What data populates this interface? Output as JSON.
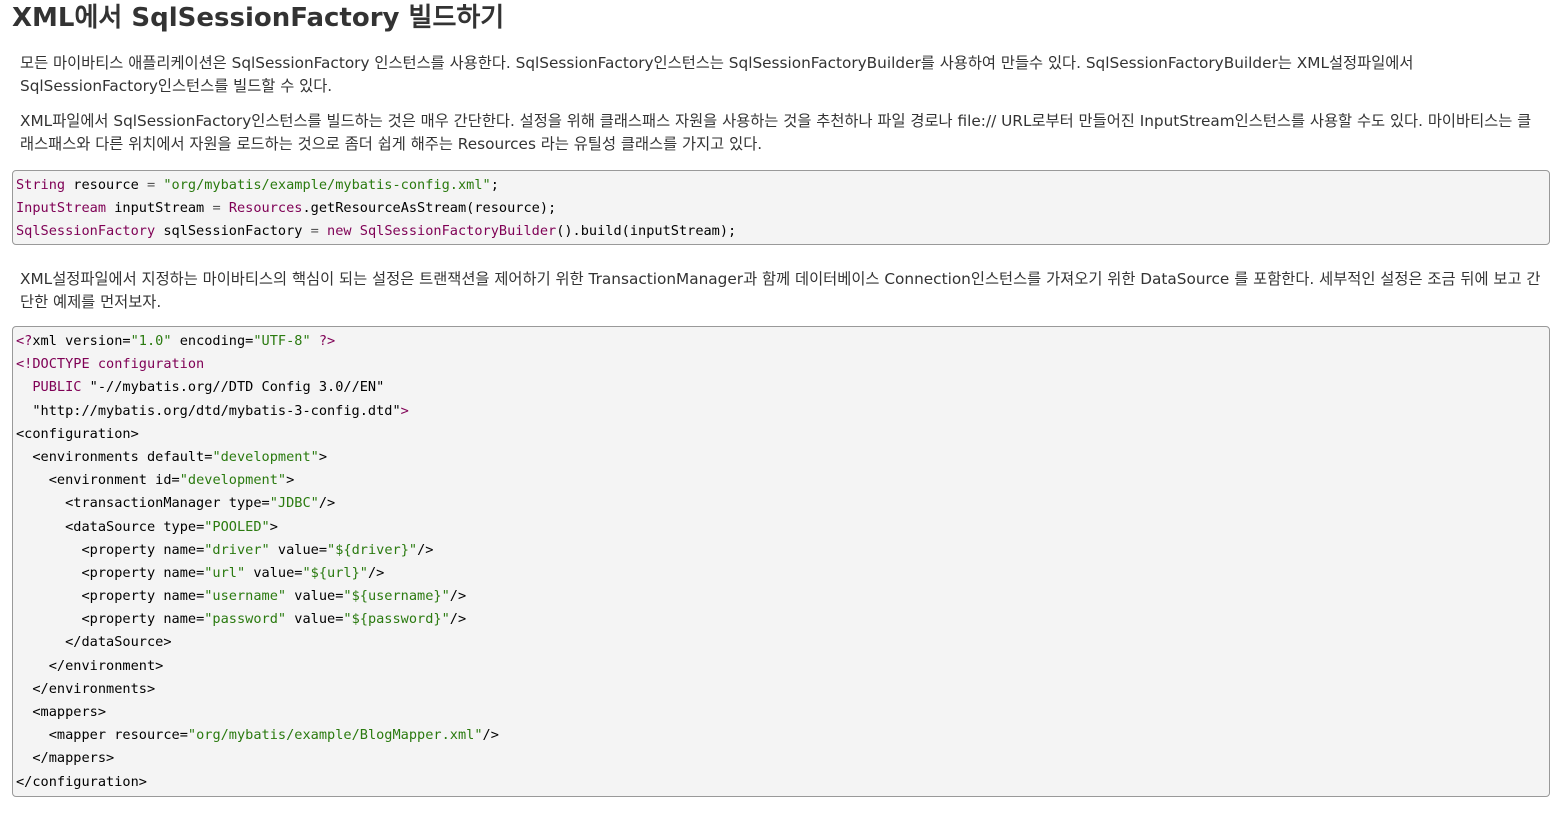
{
  "title": "XML에서 SqlSessionFactory 빌드하기",
  "paragraphs": [
    "모든 마이바티스 애플리케이션은 SqlSessionFactory 인스턴스를 사용한다. SqlSessionFactory인스턴스는 SqlSessionFactoryBuilder를 사용하여 만들수 있다. SqlSessionFactoryBuilder는 XML설정파일에서 SqlSessionFactory인스턴스를 빌드할 수 있다.",
    "XML파일에서 SqlSessionFactory인스턴스를 빌드하는 것은 매우 간단한다. 설정을 위해 클래스패스 자원을 사용하는 것을 추천하나 파일 경로나 file:// URL로부터 만들어진 InputStream인스턴스를 사용할 수도 있다. 마이바티스는 클래스패스와 다른 위치에서 자원을 로드하는 것으로 좀더 쉽게 해주는 Resources 라는 유틸성 클래스를 가지고 있다.",
    "XML설정파일에서 지정하는 마이바티스의 핵심이 되는 설정은 트랜잭션을 제어하기 위한 TransactionManager과 함께 데이터베이스 Connection인스턴스를 가져오기 위한 DataSource 를 포함한다. 세부적인 설정은 조금 뒤에 보고 간단한 예제를 먼저보자."
  ],
  "code_java": [
    [
      [
        "t",
        "String"
      ],
      [
        "n",
        " resource "
      ],
      [
        "o",
        "="
      ],
      [
        "n",
        " "
      ],
      [
        "s",
        "\"org/mybatis/example/mybatis-config.xml\""
      ],
      [
        "n",
        ";"
      ]
    ],
    [
      [
        "t",
        "InputStream"
      ],
      [
        "n",
        " inputStream "
      ],
      [
        "o",
        "="
      ],
      [
        "n",
        " "
      ],
      [
        "t",
        "Resources"
      ],
      [
        "n",
        ".getResourceAsStream(resource);"
      ]
    ],
    [
      [
        "t",
        "SqlSessionFactory"
      ],
      [
        "n",
        " sqlSessionFactory "
      ],
      [
        "o",
        "="
      ],
      [
        "n",
        " "
      ],
      [
        "t",
        "new"
      ],
      [
        "n",
        " "
      ],
      [
        "t",
        "SqlSessionFactoryBuilder"
      ],
      [
        "n",
        "().build(inputStream);"
      ]
    ]
  ],
  "code_xml": [
    [
      [
        "t",
        "<?"
      ],
      [
        "n",
        "xml version="
      ],
      [
        "s",
        "\"1.0\""
      ],
      [
        "n",
        " encoding="
      ],
      [
        "s",
        "\"UTF-8\""
      ],
      [
        "n",
        " "
      ],
      [
        "t",
        "?>"
      ]
    ],
    [
      [
        "t",
        "<!DOCTYPE configuration"
      ]
    ],
    [
      [
        "t",
        "  PUBLIC "
      ],
      [
        "n",
        "\"-//mybatis.org//DTD Config 3.0//EN\""
      ]
    ],
    [
      [
        "n",
        "  \"http://mybatis.org/dtd/mybatis-3-config.dtd\""
      ],
      [
        "t",
        ">"
      ]
    ],
    [
      [
        "n",
        "<configuration>"
      ]
    ],
    [
      [
        "n",
        "  <environments "
      ],
      [
        "n",
        "default="
      ],
      [
        "s",
        "\"development\""
      ],
      [
        "n",
        ">"
      ]
    ],
    [
      [
        "n",
        "    <environment "
      ],
      [
        "n",
        "id="
      ],
      [
        "s",
        "\"development\""
      ],
      [
        "n",
        ">"
      ]
    ],
    [
      [
        "n",
        "      <transactionManager "
      ],
      [
        "n",
        "type="
      ],
      [
        "s",
        "\"JDBC\""
      ],
      [
        "n",
        "/>"
      ]
    ],
    [
      [
        "n",
        "      <dataSource "
      ],
      [
        "n",
        "type="
      ],
      [
        "s",
        "\"POOLED\""
      ],
      [
        "n",
        ">"
      ]
    ],
    [
      [
        "n",
        "        <property "
      ],
      [
        "n",
        "name="
      ],
      [
        "s",
        "\"driver\""
      ],
      [
        "n",
        " value="
      ],
      [
        "s",
        "\"${driver}\""
      ],
      [
        "n",
        "/>"
      ]
    ],
    [
      [
        "n",
        "        <property "
      ],
      [
        "n",
        "name="
      ],
      [
        "s",
        "\"url\""
      ],
      [
        "n",
        " value="
      ],
      [
        "s",
        "\"${url}\""
      ],
      [
        "n",
        "/>"
      ]
    ],
    [
      [
        "n",
        "        <property "
      ],
      [
        "n",
        "name="
      ],
      [
        "s",
        "\"username\""
      ],
      [
        "n",
        " value="
      ],
      [
        "s",
        "\"${username}\""
      ],
      [
        "n",
        "/>"
      ]
    ],
    [
      [
        "n",
        "        <property "
      ],
      [
        "n",
        "name="
      ],
      [
        "s",
        "\"password\""
      ],
      [
        "n",
        " value="
      ],
      [
        "s",
        "\"${password}\""
      ],
      [
        "n",
        "/>"
      ]
    ],
    [
      [
        "n",
        "      </dataSource>"
      ]
    ],
    [
      [
        "n",
        "    </environment>"
      ]
    ],
    [
      [
        "n",
        "  </environments>"
      ]
    ],
    [
      [
        "n",
        "  <mappers>"
      ]
    ],
    [
      [
        "n",
        "    <mapper "
      ],
      [
        "n",
        "resource="
      ],
      [
        "s",
        "\"org/mybatis/example/BlogMapper.xml\""
      ],
      [
        "n",
        "/>"
      ]
    ],
    [
      [
        "n",
        "  </mappers>"
      ]
    ],
    [
      [
        "n",
        "</configuration>"
      ]
    ]
  ]
}
